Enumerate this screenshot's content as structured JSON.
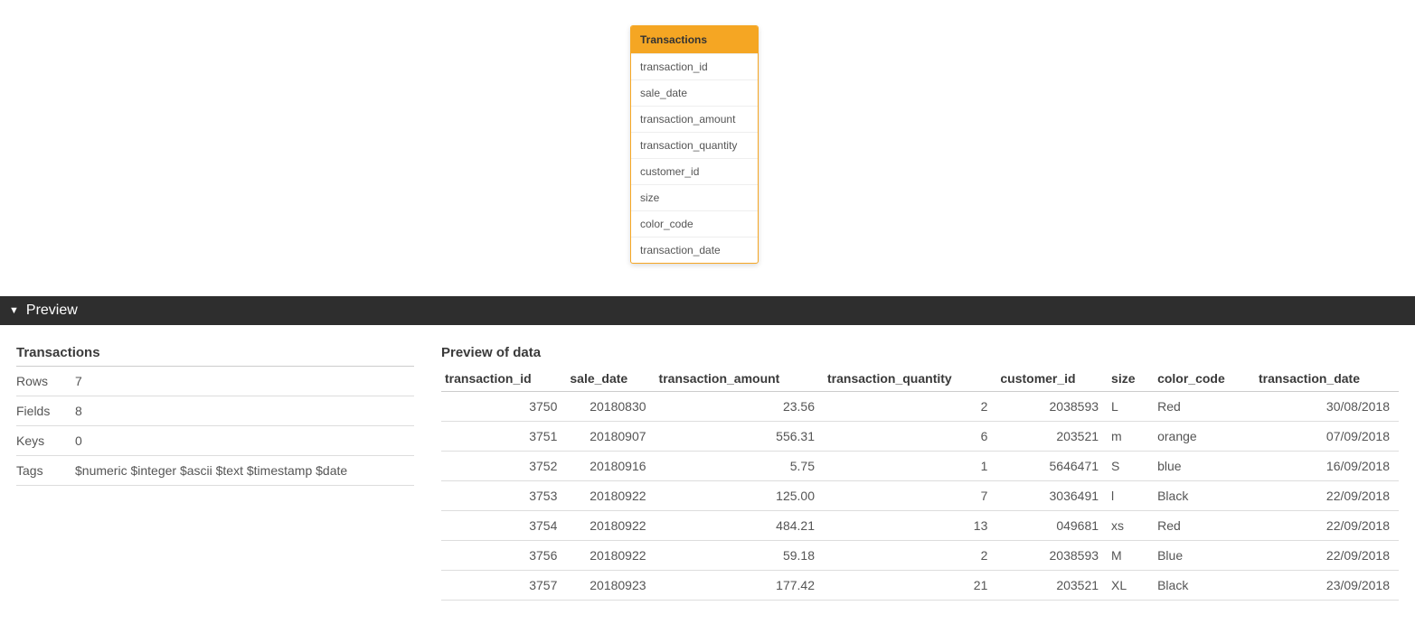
{
  "table_card": {
    "title": "Transactions",
    "fields": [
      "transaction_id",
      "sale_date",
      "transaction_amount",
      "transaction_quantity",
      "customer_id",
      "size",
      "color_code",
      "transaction_date"
    ]
  },
  "preview_bar": {
    "label": "Preview"
  },
  "meta": {
    "title": "Transactions",
    "rows": [
      {
        "k": "Rows",
        "v": "7"
      },
      {
        "k": "Fields",
        "v": "8"
      },
      {
        "k": "Keys",
        "v": "0"
      },
      {
        "k": "Tags",
        "v": "$numeric $integer $ascii $text $timestamp $date"
      }
    ]
  },
  "data_preview": {
    "title": "Preview of data",
    "columns": [
      {
        "name": "transaction_id",
        "align": "num"
      },
      {
        "name": "sale_date",
        "align": "num"
      },
      {
        "name": "transaction_amount",
        "align": "num"
      },
      {
        "name": "transaction_quantity",
        "align": "num"
      },
      {
        "name": "customer_id",
        "align": "num"
      },
      {
        "name": "size",
        "align": "txt"
      },
      {
        "name": "color_code",
        "align": "txt"
      },
      {
        "name": "transaction_date",
        "align": "num"
      }
    ],
    "rows": [
      [
        "3750",
        "20180830",
        "23.56",
        "2",
        "2038593",
        "L",
        "Red",
        "30/08/2018"
      ],
      [
        "3751",
        "20180907",
        "556.31",
        "6",
        "203521",
        "m",
        "orange",
        "07/09/2018"
      ],
      [
        "3752",
        "20180916",
        "5.75",
        "1",
        "5646471",
        "S",
        "blue",
        "16/09/2018"
      ],
      [
        "3753",
        "20180922",
        "125.00",
        "7",
        "3036491",
        "l",
        "Black",
        "22/09/2018"
      ],
      [
        "3754",
        "20180922",
        "484.21",
        "13",
        "049681",
        "xs",
        "Red",
        "22/09/2018"
      ],
      [
        "3756",
        "20180922",
        "59.18",
        "2",
        "2038593",
        "M",
        "Blue",
        "22/09/2018"
      ],
      [
        "3757",
        "20180923",
        "177.42",
        "21",
        "203521",
        "XL",
        "Black",
        "23/09/2018"
      ]
    ]
  }
}
